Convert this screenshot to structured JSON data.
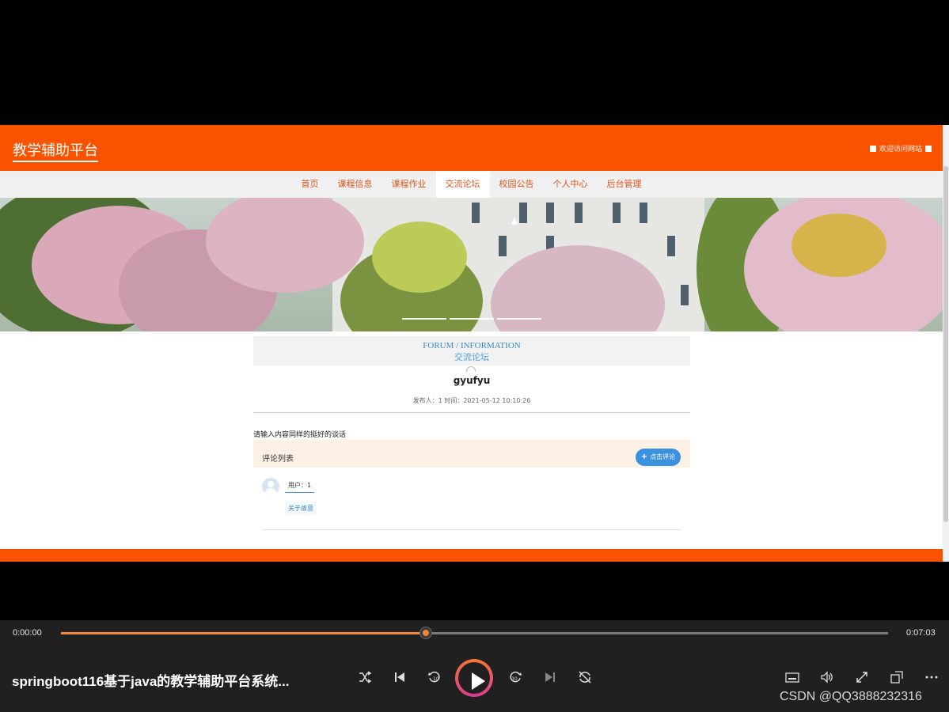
{
  "site": {
    "title": "教学辅助平台",
    "welcome": "欢迎访问网站"
  },
  "nav": {
    "items": [
      "首页",
      "课程信息",
      "课程作业",
      "交流论坛",
      "校园公告",
      "个人中心",
      "后台管理"
    ],
    "active": "交流论坛"
  },
  "section": {
    "en": "FORUM / INFORMATION",
    "cn": "交流论坛"
  },
  "post": {
    "title": "gyufyu",
    "meta": "发布人：1 时间：2021-05-12 10:10:26",
    "content": "请输入内容同样的挺好的谈话"
  },
  "comments": {
    "header": "评论列表",
    "button": "点击评论",
    "items": [
      {
        "user": "用户：1",
        "text": "关于故意"
      }
    ]
  },
  "player": {
    "current_time": "0:00:00",
    "total_time": "0:07:03",
    "progress": 0.441,
    "title": "springboot116基于java的教学辅助平台系统...",
    "icons": [
      "shuffle-icon",
      "previous-icon",
      "rewind-10-icon",
      "play-icon",
      "forward-30-icon",
      "next-icon",
      "repeat-icon",
      "captions-icon",
      "volume-icon",
      "fullscreen-icon",
      "mini-player-icon",
      "more-icon"
    ]
  },
  "watermark": "CSDN @QQ3888232316",
  "colors": {
    "brand_orange": "#fb5200",
    "nav_text": "#e1541b",
    "link_blue": "#3a88c4",
    "button_blue": "#3a91e0",
    "player_accent": "#f08a3a"
  }
}
